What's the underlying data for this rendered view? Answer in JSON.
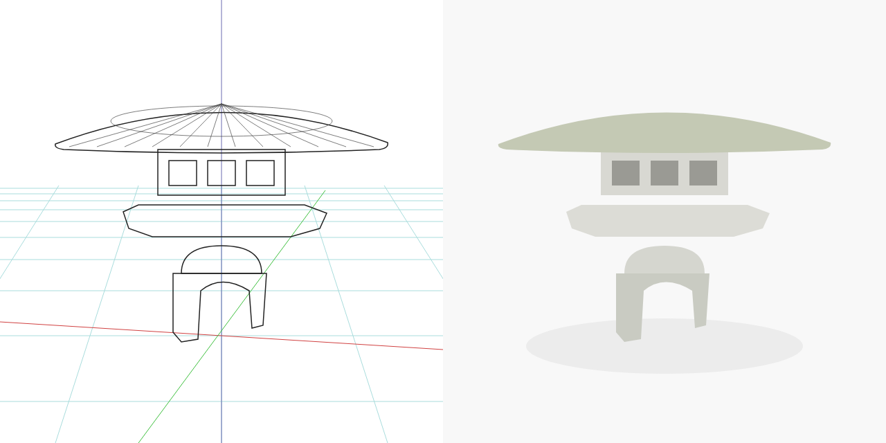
{
  "viewports": [
    {
      "kind": "wireframe"
    },
    {
      "kind": "render"
    }
  ]
}
